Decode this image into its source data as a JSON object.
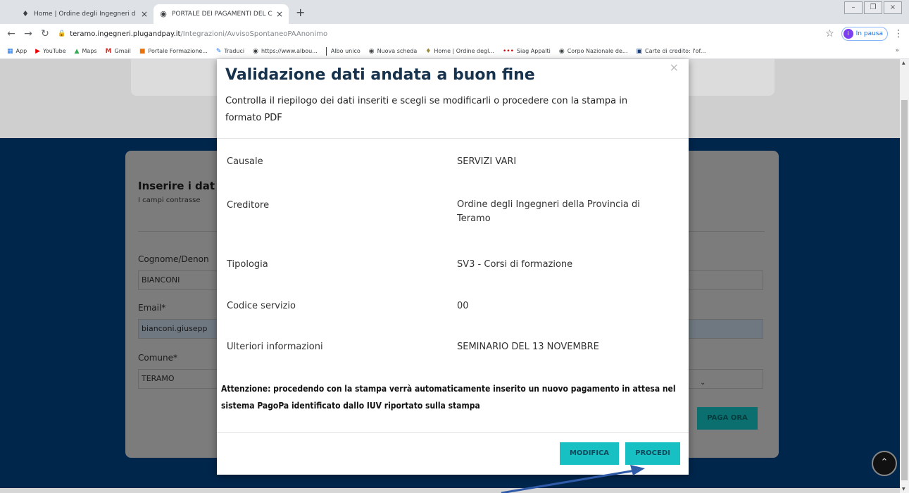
{
  "browser": {
    "tabs": [
      {
        "title": "Home | Ordine degli Ingegneri d",
        "active": false
      },
      {
        "title": "PORTALE DEI PAGAMENTI DEL C",
        "active": true
      }
    ],
    "url_host": "teramo.ingegneri.plugandpay.it",
    "url_path": "/Integrazioni/AvvisoSpontaneoPAAnonimo",
    "profile_label": "In pausa",
    "profile_initial": "i",
    "bookmarks": [
      "App",
      "YouTube",
      "Maps",
      "Gmail",
      "Portale Formazione...",
      "Traduci",
      "https://www.albou...",
      "Albo unico",
      "Nuova scheda",
      "Home | Ordine degl...",
      "Siag Appalti",
      "Corpo Nazionale de...",
      "Carte di credito: l'of..."
    ],
    "bookmarks_more": "»"
  },
  "form": {
    "heading": "Inserire i dat",
    "subheading": "I campi contrasse",
    "fields": [
      {
        "label": "Cognome/Denon",
        "value": "BIANCONI"
      },
      {
        "label": "Email*",
        "value": "bianconi.giusepp"
      },
      {
        "label": "Comune*",
        "value": "TERAMO"
      }
    ],
    "pay_button": "PAGA ORA"
  },
  "modal": {
    "title": "Validazione dati andata a buon fine",
    "description": "Controlla il riepilogo dei dati inseriti e scegli se modificarli o procedere con la stampa in formato PDF",
    "rows": [
      {
        "label": "Causale",
        "value": "SERVIZI VARI"
      },
      {
        "label": "Creditore",
        "value": "Ordine degli Ingegneri della Provincia di Teramo"
      },
      {
        "label": "Tipologia",
        "value": "SV3 - Corsi di formazione"
      },
      {
        "label": "Codice servizio",
        "value": "00"
      },
      {
        "label": "Ulteriori informazioni",
        "value": "SEMINARIO DEL 13 NOVEMBRE"
      }
    ],
    "warning": "Attenzione: procedendo con la stampa verrà automaticamente inserito un nuovo pagamento in attesa nel sistema PagoPa identificato dallo IUV riportato sulla stampa",
    "buttons": {
      "modifica": "MODIFICA",
      "procedi": "PROCEDI"
    },
    "close_glyph": "×"
  },
  "colors": {
    "accent_button": "#17c0c3",
    "page_blue": "#01264c",
    "title_color": "#17324d",
    "annotation_arrow": "#2f5aa8"
  }
}
